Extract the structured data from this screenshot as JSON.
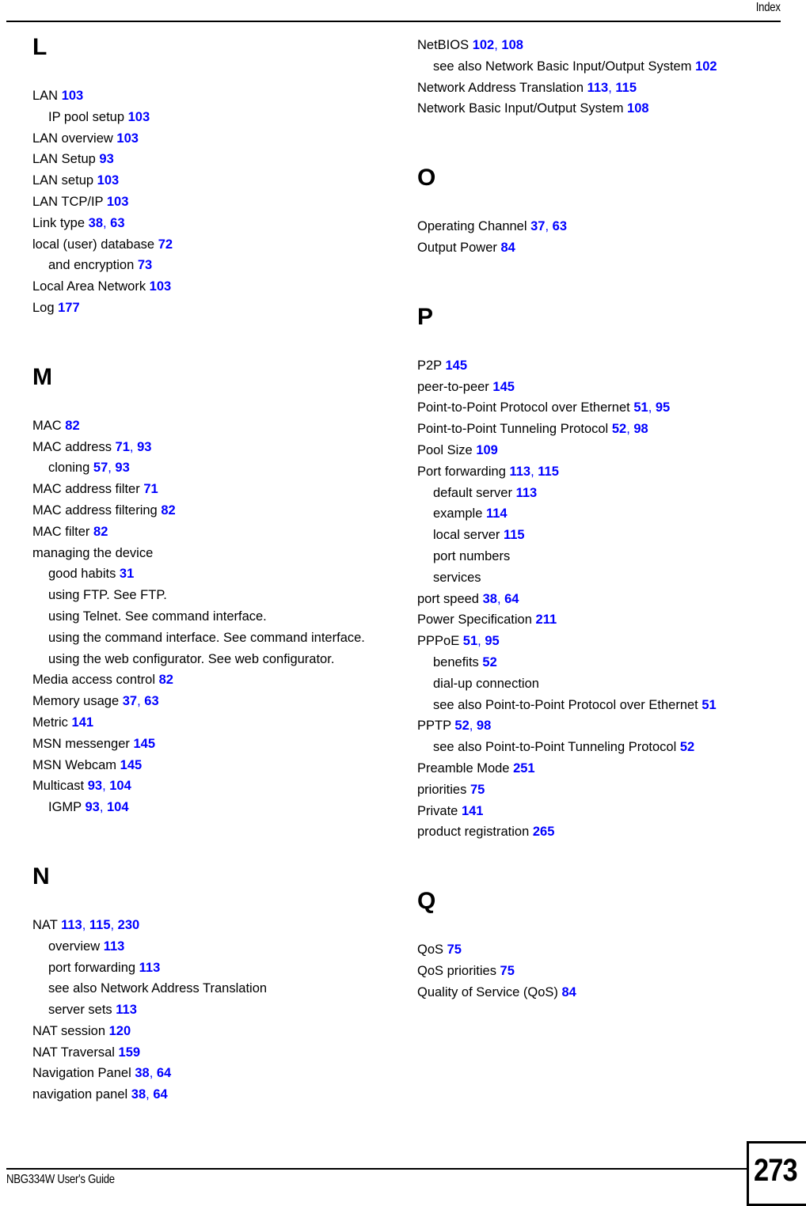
{
  "header": {
    "title": "Index"
  },
  "footer": {
    "guide_name": "NBG334W User's Guide",
    "page_number": "273"
  },
  "colors": {
    "page_reference": "#0000FF",
    "text": "#000000",
    "background": "#FFFFFF"
  },
  "columns": [
    {
      "id": "left",
      "sections": [
        {
          "letter": "L",
          "entries": [
            {
              "level": 0,
              "text": "LAN",
              "pages": [
                "103"
              ]
            },
            {
              "level": 1,
              "text": "IP pool setup",
              "pages": [
                "103"
              ]
            },
            {
              "level": 0,
              "text": "LAN overview",
              "pages": [
                "103"
              ]
            },
            {
              "level": 0,
              "text": "LAN Setup",
              "pages": [
                "93"
              ]
            },
            {
              "level": 0,
              "text": "LAN setup",
              "pages": [
                "103"
              ]
            },
            {
              "level": 0,
              "text": "LAN TCP/IP",
              "pages": [
                "103"
              ]
            },
            {
              "level": 0,
              "text": "Link type",
              "pages": [
                "38",
                "63"
              ]
            },
            {
              "level": 0,
              "text": "local (user) database",
              "pages": [
                "72"
              ]
            },
            {
              "level": 1,
              "text": "and encryption",
              "pages": [
                "73"
              ]
            },
            {
              "level": 0,
              "text": "Local Area Network",
              "pages": [
                "103"
              ]
            },
            {
              "level": 0,
              "text": "Log",
              "pages": [
                "177"
              ]
            }
          ]
        },
        {
          "letter": "M",
          "entries": [
            {
              "level": 0,
              "text": "MAC",
              "pages": [
                "82"
              ]
            },
            {
              "level": 0,
              "text": "MAC address",
              "pages": [
                "71",
                "93"
              ]
            },
            {
              "level": 1,
              "text": "cloning",
              "pages": [
                "57",
                "93"
              ]
            },
            {
              "level": 0,
              "text": "MAC address filter",
              "pages": [
                "71"
              ]
            },
            {
              "level": 0,
              "text": "MAC address filtering",
              "pages": [
                "82"
              ]
            },
            {
              "level": 0,
              "text": "MAC filter",
              "pages": [
                "82"
              ]
            },
            {
              "level": 0,
              "text": "managing the device",
              "pages": []
            },
            {
              "level": 1,
              "text": "good habits",
              "pages": [
                "31"
              ]
            },
            {
              "level": 1,
              "text": "using FTP. See FTP.",
              "pages": []
            },
            {
              "level": 1,
              "text": "using Telnet. See command interface.",
              "pages": []
            },
            {
              "level": 1,
              "text": "using the command interface. See command interface.",
              "pages": []
            },
            {
              "level": 1,
              "text": "using the web configurator. See web configurator.",
              "pages": []
            },
            {
              "level": 0,
              "text": "Media access control",
              "pages": [
                "82"
              ]
            },
            {
              "level": 0,
              "text": "Memory usage",
              "pages": [
                "37",
                "63"
              ]
            },
            {
              "level": 0,
              "text": "Metric",
              "pages": [
                "141"
              ]
            },
            {
              "level": 0,
              "text": "MSN messenger",
              "pages": [
                "145"
              ]
            },
            {
              "level": 0,
              "text": "MSN Webcam",
              "pages": [
                "145"
              ]
            },
            {
              "level": 0,
              "text": "Multicast",
              "pages": [
                "93",
                "104"
              ]
            },
            {
              "level": 1,
              "text": "IGMP",
              "pages": [
                "93",
                "104"
              ]
            }
          ]
        },
        {
          "letter": "N",
          "entries": [
            {
              "level": 0,
              "text": "NAT",
              "pages": [
                "113",
                "115",
                "230"
              ]
            },
            {
              "level": 1,
              "text": "overview",
              "pages": [
                "113"
              ]
            },
            {
              "level": 1,
              "text": "port forwarding",
              "pages": [
                "113"
              ]
            },
            {
              "level": 1,
              "text": "see also Network Address Translation",
              "pages": []
            },
            {
              "level": 1,
              "text": "server sets",
              "pages": [
                "113"
              ]
            },
            {
              "level": 0,
              "text": "NAT session",
              "pages": [
                "120"
              ]
            },
            {
              "level": 0,
              "text": "NAT Traversal",
              "pages": [
                "159"
              ]
            },
            {
              "level": 0,
              "text": "Navigation Panel",
              "pages": [
                "38",
                "64"
              ]
            },
            {
              "level": 0,
              "text": "navigation panel",
              "pages": [
                "38",
                "64"
              ]
            }
          ]
        }
      ]
    },
    {
      "id": "right",
      "sections": [
        {
          "letter": "",
          "entries": [
            {
              "level": 0,
              "text": "NetBIOS",
              "pages": [
                "102",
                "108"
              ]
            },
            {
              "level": 1,
              "text": "see also Network Basic Input/Output System",
              "pages": [
                "102"
              ]
            },
            {
              "level": 0,
              "text": "Network Address Translation",
              "pages": [
                "113",
                "115"
              ]
            },
            {
              "level": 0,
              "text": "Network Basic Input/Output System",
              "pages": [
                "108"
              ]
            }
          ]
        },
        {
          "letter": "O",
          "entries": [
            {
              "level": 0,
              "text": "Operating Channel",
              "pages": [
                "37",
                "63"
              ]
            },
            {
              "level": 0,
              "text": "Output Power",
              "pages": [
                "84"
              ]
            }
          ]
        },
        {
          "letter": "P",
          "entries": [
            {
              "level": 0,
              "text": "P2P",
              "pages": [
                "145"
              ]
            },
            {
              "level": 0,
              "text": "peer-to-peer",
              "pages": [
                "145"
              ]
            },
            {
              "level": 0,
              "text": "Point-to-Point Protocol over Ethernet",
              "pages": [
                "51",
                "95"
              ]
            },
            {
              "level": 0,
              "text": "Point-to-Point Tunneling Protocol",
              "pages": [
                "52",
                "98"
              ]
            },
            {
              "level": 0,
              "text": "Pool Size",
              "pages": [
                "109"
              ]
            },
            {
              "level": 0,
              "text": "Port forwarding",
              "pages": [
                "113",
                "115"
              ]
            },
            {
              "level": 1,
              "text": "default server",
              "pages": [
                "113"
              ]
            },
            {
              "level": 1,
              "text": "example",
              "pages": [
                "114"
              ]
            },
            {
              "level": 1,
              "text": "local server",
              "pages": [
                "115"
              ]
            },
            {
              "level": 1,
              "text": "port numbers",
              "pages": []
            },
            {
              "level": 1,
              "text": "services",
              "pages": []
            },
            {
              "level": 0,
              "text": "port speed",
              "pages": [
                "38",
                "64"
              ]
            },
            {
              "level": 0,
              "text": "Power Specification",
              "pages": [
                "211"
              ]
            },
            {
              "level": 0,
              "text": "PPPoE",
              "pages": [
                "51",
                "95"
              ]
            },
            {
              "level": 1,
              "text": "benefits",
              "pages": [
                "52"
              ]
            },
            {
              "level": 1,
              "text": "dial-up connection",
              "pages": []
            },
            {
              "level": 1,
              "text": "see also Point-to-Point Protocol over Ethernet",
              "pages": [
                "51"
              ]
            },
            {
              "level": 0,
              "text": "PPTP",
              "pages": [
                "52",
                "98"
              ]
            },
            {
              "level": 1,
              "text": "see also Point-to-Point Tunneling Protocol",
              "pages": [
                "52"
              ]
            },
            {
              "level": 0,
              "text": "Preamble Mode",
              "pages": [
                "251"
              ]
            },
            {
              "level": 0,
              "text": "priorities",
              "pages": [
                "75"
              ]
            },
            {
              "level": 0,
              "text": "Private",
              "pages": [
                "141"
              ]
            },
            {
              "level": 0,
              "text": "product registration",
              "pages": [
                "265"
              ]
            }
          ]
        },
        {
          "letter": "Q",
          "entries": [
            {
              "level": 0,
              "text": "QoS",
              "pages": [
                "75"
              ]
            },
            {
              "level": 0,
              "text": "QoS priorities",
              "pages": [
                "75"
              ]
            },
            {
              "level": 0,
              "text": "Quality of Service (QoS)",
              "pages": [
                "84"
              ]
            }
          ]
        }
      ]
    }
  ]
}
